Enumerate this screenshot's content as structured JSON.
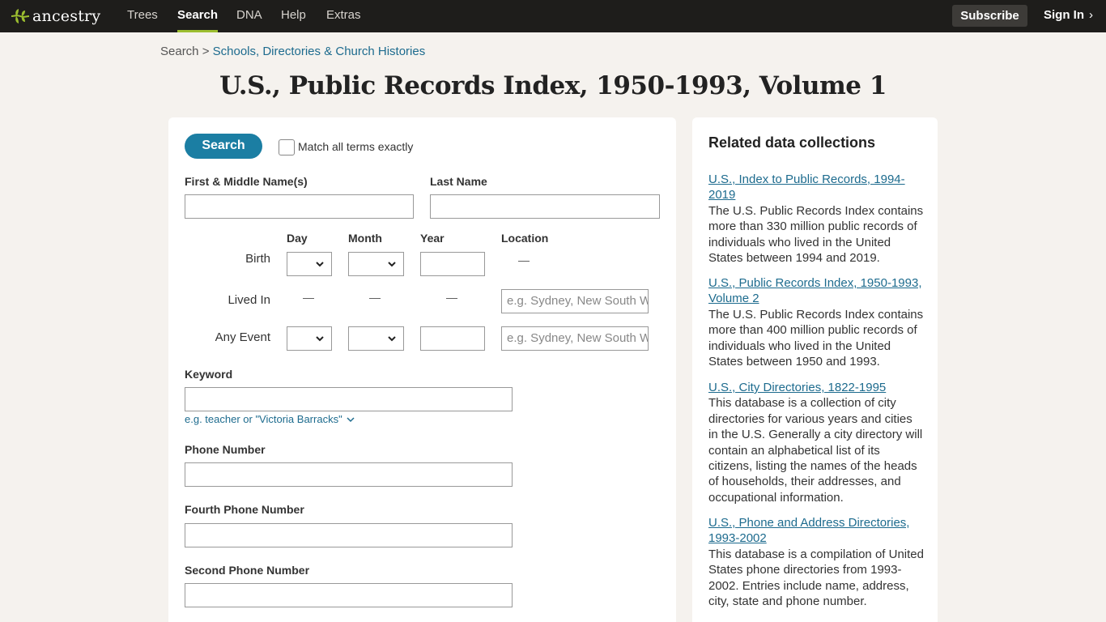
{
  "nav": {
    "logo_text": "ancestry",
    "items": [
      "Trees",
      "Search",
      "DNA",
      "Help",
      "Extras"
    ],
    "active": "Search",
    "subscribe": "Subscribe",
    "signin": "Sign In",
    "brand_green": "#9cbe30",
    "bar_color": "#1e1d1b"
  },
  "breadcrumb": {
    "root": "Search",
    "separator": ">",
    "link": "Schools, Directories & Church Histories"
  },
  "page_title": "U.S., Public Records Index, 1950-1993, Volume 1",
  "search_form": {
    "search_button": "Search",
    "match_exact_label": "Match all terms exactly",
    "first_name_label": "First & Middle Name(s)",
    "last_name_label": "Last Name",
    "columns": {
      "day": "Day",
      "month": "Month",
      "year": "Year",
      "location": "Location"
    },
    "rows": {
      "birth": "Birth",
      "lived_in": "Lived In",
      "any_event": "Any Event"
    },
    "dash": "—",
    "location_placeholder": "e.g. Sydney, New South Wales",
    "keyword_label": "Keyword",
    "keyword_hint": "e.g. teacher or \"Victoria Barracks\"",
    "phone_label": "Phone Number",
    "fourth_phone_label": "Fourth Phone Number",
    "second_phone_label": "Second Phone Number",
    "button_color": "#1b7ea3"
  },
  "related": {
    "title": "Related data collections",
    "items": [
      {
        "link": "U.S., Index to Public Records, 1994-2019",
        "desc": "The U.S. Public Records Index contains more than 330 million public records of individuals who lived in the United States between 1994 and 2019."
      },
      {
        "link": "U.S., Public Records Index, 1950-1993, Volume 2",
        "desc": "The U.S. Public Records Index contains more than 400 million public records of individuals who lived in the United States between 1950 and 1993."
      },
      {
        "link": "U.S., City Directories, 1822-1995",
        "desc": "This database is a collection of city directories for various years and cities in the U.S. Generally a city directory will contain an alphabetical list of its citizens, listing the names of the heads of households, their addresses, and occupational information."
      },
      {
        "link": "U.S., Phone and Address Directories, 1993-2002",
        "desc": "This database is a compilation of United States phone directories from 1993-2002. Entries include name, address, city, state and phone number."
      }
    ]
  }
}
